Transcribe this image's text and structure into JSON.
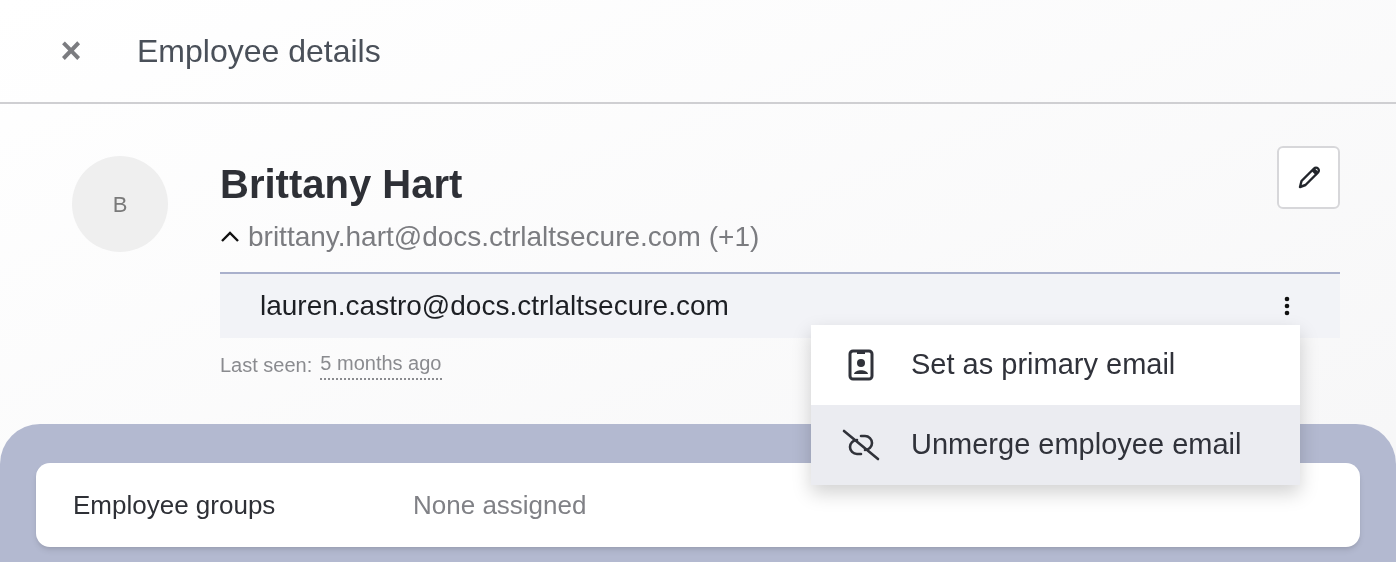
{
  "header": {
    "close_icon": "×",
    "title": "Employee details"
  },
  "employee": {
    "avatar_initial": "B",
    "name": "Brittany Hart",
    "primary_email": "brittany.hart@docs.ctrlaltsecure.com",
    "extra_count": "(+1)",
    "emails_expanded": true,
    "other_emails": [
      {
        "address": "lauren.castro@docs.ctrlaltsecure.com",
        "menu_open": true
      }
    ],
    "last_seen_label": "Last seen:",
    "last_seen_value": "5 months ago"
  },
  "email_menu": [
    {
      "kind": "badge",
      "label": "Set as primary email",
      "selected": false
    },
    {
      "kind": "unlink",
      "label": "Unmerge employee email",
      "selected": true
    }
  ],
  "details": [
    {
      "label": "Employee groups",
      "value": "None assigned"
    }
  ]
}
